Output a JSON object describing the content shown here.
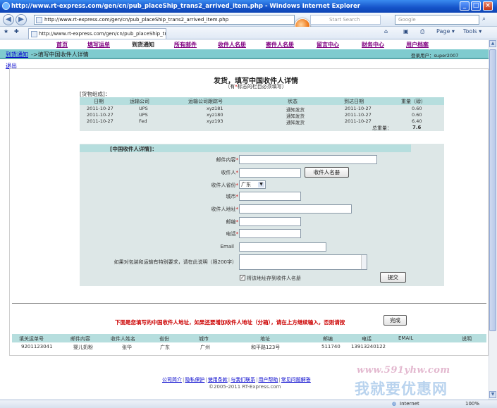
{
  "browser": {
    "title": "http://www.rt-express.com/gen/cn/pub_placeShip_trans2_arrived_item.php - Windows Internet Explorer",
    "address": "http://www.rt-express.com/gen/cn/pub_placeShip_trans2_arrived_item.php",
    "tab_title": "http://www.rt-express.com/gen/cn/pub_placeShip_tr...",
    "start_search": "Start Search",
    "search_placeholder": "Google",
    "toolbar_page": "Page",
    "toolbar_tools": "Tools",
    "status_zone": "Internet",
    "status_zoom": "100%"
  },
  "site_nav": {
    "items": [
      "首页",
      "填写运单",
      "到货通知",
      "所有邮件",
      "收件人名册",
      "寄件人名册",
      "留言中心",
      "财务中心",
      "用户档案"
    ],
    "active_index": 2
  },
  "breadcrumb": {
    "link": "到货通知",
    "current": "->填写中国收件人详情",
    "login_user": "登录用户：super2007",
    "logout": "退出"
  },
  "page": {
    "heading": "发货，填写中国收件人详情",
    "subheading_prefix": "（有",
    "subheading_star": "*",
    "subheading_suffix": "标志的栏目必须填写）"
  },
  "goods": {
    "label": "[货物组成]：",
    "columns": [
      "日期",
      "运输公司",
      "运输公司跟踪号",
      "状态",
      "到达日期",
      "重量（磅）"
    ],
    "rows": [
      [
        "2011-10-27",
        "UPS",
        "xyz181",
        "通知发货",
        "2011-10-27",
        "0.60"
      ],
      [
        "2011-10-27",
        "UPS",
        "xyz180",
        "通知发货",
        "2011-10-27",
        "0.60"
      ],
      [
        "2011-10-27",
        "Fed",
        "xyz193",
        "通知发货",
        "2011-10-27",
        "6.40"
      ]
    ],
    "total_label": "总重量：",
    "total_value": "7.6"
  },
  "form": {
    "title": "[中国收件人详情]：",
    "fields": {
      "content": {
        "label": "邮件内容",
        "value": ""
      },
      "recipient": {
        "label": "收件人",
        "value": ""
      },
      "province": {
        "label": "收件人省份",
        "value": "广东"
      },
      "city": {
        "label": "城市",
        "value": ""
      },
      "address": {
        "label": "收件人地址",
        "value": ""
      },
      "postcode": {
        "label": "邮编",
        "value": ""
      },
      "phone": {
        "label": "电话",
        "value": ""
      },
      "email": {
        "label": "Email",
        "value": ""
      },
      "remark": {
        "label": "如果对包装和运输有特别要求，请在此说明（限200字）",
        "value": ""
      }
    },
    "recipient_book_button": "收件人名册",
    "save_checkbox_label": "将该地址存到收件人名册",
    "save_checked": true,
    "submit_button": "提交"
  },
  "notice": {
    "text": "下面是您填写的中国收件人地址，如果还要增加收件人地址（分箱），请在上方继续输入，否则请按",
    "done_button": "完成"
  },
  "recipient_list": {
    "columns": [
      "填关运单号",
      "邮件内容",
      "收件人姓名",
      "省份",
      "城市",
      "地址",
      "邮编",
      "电话",
      "EMAIL",
      "说明"
    ],
    "rows": [
      [
        "9201123041",
        "婴儿奶粉",
        "张华",
        "广东",
        "广州",
        "和平路123号",
        "511740",
        "13913240122",
        "",
        ""
      ]
    ]
  },
  "footer": {
    "links": [
      "公司简介",
      "隐私保护",
      "使用条款",
      "与我们联系",
      "用户帮助",
      "常见问题解答"
    ],
    "copyright": "©2005-2011 RT-Express.com"
  },
  "watermark": {
    "url": "www.591yhw.com",
    "slogan": "我就要优惠网"
  },
  "colors": {
    "titlebar": "#1553c9",
    "crumb_bar": "#7fcbcf",
    "table_head": "#b6dede",
    "form_bg": "#dde7e7",
    "notice": "#cc0000",
    "nav_link": "#800080"
  }
}
